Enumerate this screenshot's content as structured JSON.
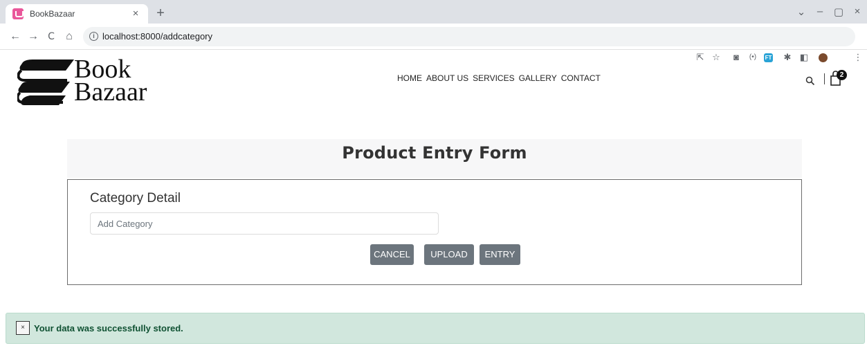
{
  "browser": {
    "tab_title": "BookBazaar",
    "tab_close": "×",
    "new_tab": "+",
    "url": "localhost:8000/addcategory",
    "window_controls": {
      "minimize_chevron": "⌄",
      "minimize": "–",
      "restore": "▢",
      "close": "×"
    },
    "nav_icons": {
      "back": "←",
      "forward": "→",
      "reload": "C",
      "home": "⌂"
    },
    "extension_icons": [
      "share-icon",
      "star-icon",
      "camera-icon",
      "podcast-icon",
      "ft-extension-icon",
      "puzzle-icon",
      "sidepanel-icon",
      "profile-avatar-icon",
      "menu-dots-icon"
    ],
    "ft_label": "FT"
  },
  "header": {
    "logo_line1": "Book",
    "logo_line2": "Bazaar",
    "nav": [
      "HOME",
      "ABOUT US",
      "SERVICES",
      "GALLERY",
      "CONTACT"
    ],
    "cart_count": "2"
  },
  "form": {
    "title": "Product Entry Form",
    "section_label": "Category Detail",
    "input_value": "",
    "input_placeholder": "Add Category",
    "buttons": {
      "cancel": "CANCEL",
      "upload": "UPLOAD",
      "entry": "ENTRY"
    }
  },
  "alert": {
    "close": "×",
    "message": "Your data was successfully stored."
  },
  "colors": {
    "button_bg": "#6c757d",
    "alert_bg": "#d1e7dd",
    "alert_text": "#0f5132",
    "tab_favicon": "#e9579a"
  }
}
